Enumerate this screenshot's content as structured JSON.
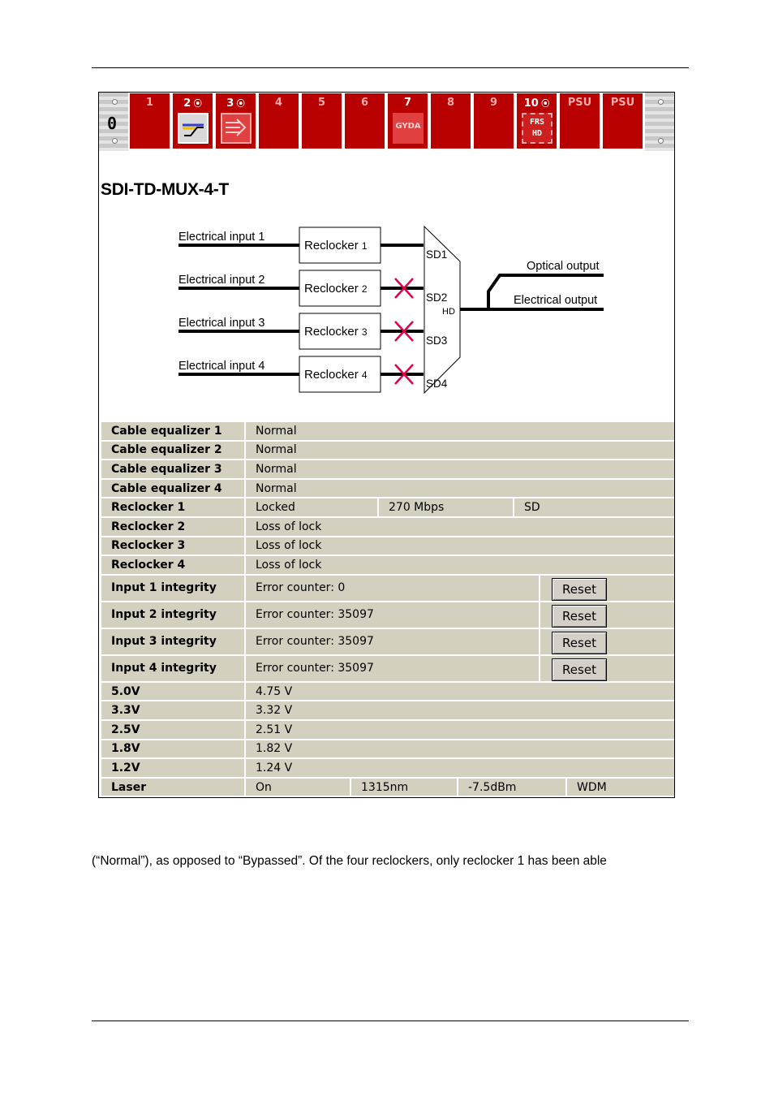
{
  "rack": {
    "left_label": "0",
    "slots": [
      {
        "num": "1",
        "wireless": false,
        "icon": "none"
      },
      {
        "num": "2",
        "wireless": true,
        "icon": "cable-equalizer-icon"
      },
      {
        "num": "3",
        "wireless": true,
        "icon": "mux-icon"
      },
      {
        "num": "4",
        "wireless": false,
        "icon": "none"
      },
      {
        "num": "5",
        "wireless": false,
        "icon": "none"
      },
      {
        "num": "6",
        "wireless": false,
        "icon": "none"
      },
      {
        "num": "7",
        "wireless": false,
        "icon": "gyda-icon",
        "icon_text": "GYDA"
      },
      {
        "num": "8",
        "wireless": false,
        "icon": "none"
      },
      {
        "num": "9",
        "wireless": false,
        "icon": "none"
      },
      {
        "num": "10",
        "wireless": true,
        "icon": "frs-hd-icon",
        "icon_text1": "FRS",
        "icon_text2": "HD"
      },
      {
        "num": "PSU",
        "wireless": false,
        "icon": "none"
      },
      {
        "num": "PSU",
        "wireless": false,
        "icon": "none"
      }
    ],
    "slot_color": "#b80000"
  },
  "card_title": "SDI-TD-MUX-4-T",
  "diagram": {
    "inputs": [
      "Electrical input  1",
      "Electrical input  2",
      "Electrical input  3",
      "Electrical input  4"
    ],
    "reclocker_word": "Reclocker",
    "reclocker_nums": [
      "1",
      "2",
      "3",
      "4"
    ],
    "mux_ports": [
      "SD1",
      "SD2",
      "SD3",
      "SD4"
    ],
    "mux_out": "HD",
    "outputs": [
      "Optical output",
      "Electrical output"
    ],
    "cross_color": "#e0004a"
  },
  "status": {
    "rows": [
      {
        "label": "Cable equalizer 1",
        "values": [
          "Normal"
        ]
      },
      {
        "label": "Cable equalizer 2",
        "values": [
          "Normal"
        ]
      },
      {
        "label": "Cable equalizer 3",
        "values": [
          "Normal"
        ]
      },
      {
        "label": "Cable equalizer 4",
        "values": [
          "Normal"
        ]
      },
      {
        "label": "Reclocker 1",
        "values": [
          "Locked",
          "270 Mbps",
          "SD"
        ]
      },
      {
        "label": "Reclocker 2",
        "values": [
          "Loss of lock"
        ]
      },
      {
        "label": "Reclocker 3",
        "values": [
          "Loss of lock"
        ]
      },
      {
        "label": "Reclocker 4",
        "values": [
          "Loss of lock"
        ]
      },
      {
        "label": "Input 1 integrity",
        "values": [
          "Error counter: 0"
        ],
        "button": "Reset"
      },
      {
        "label": "Input 2 integrity",
        "values": [
          "Error counter: 35097"
        ],
        "button": "Reset"
      },
      {
        "label": "Input 3 integrity",
        "values": [
          "Error counter: 35097"
        ],
        "button": "Reset"
      },
      {
        "label": "Input 4 integrity",
        "values": [
          "Error counter: 35097"
        ],
        "button": "Reset"
      },
      {
        "label": "5.0V",
        "values": [
          "4.75 V"
        ]
      },
      {
        "label": "3.3V",
        "values": [
          "3.32 V"
        ]
      },
      {
        "label": "2.5V",
        "values": [
          "2.51 V"
        ]
      },
      {
        "label": "1.8V",
        "values": [
          "1.82 V"
        ]
      },
      {
        "label": "1.2V",
        "values": [
          "1.24 V"
        ]
      },
      {
        "label": "Laser",
        "values": [
          "On",
          "1315nm",
          "-7.5dBm",
          "WDM"
        ]
      }
    ],
    "cell_color": "#d4d0c0"
  },
  "body_text": "(“Normal”), as opposed to “Bypassed”. Of the four reclockers, only reclocker 1 has been able"
}
